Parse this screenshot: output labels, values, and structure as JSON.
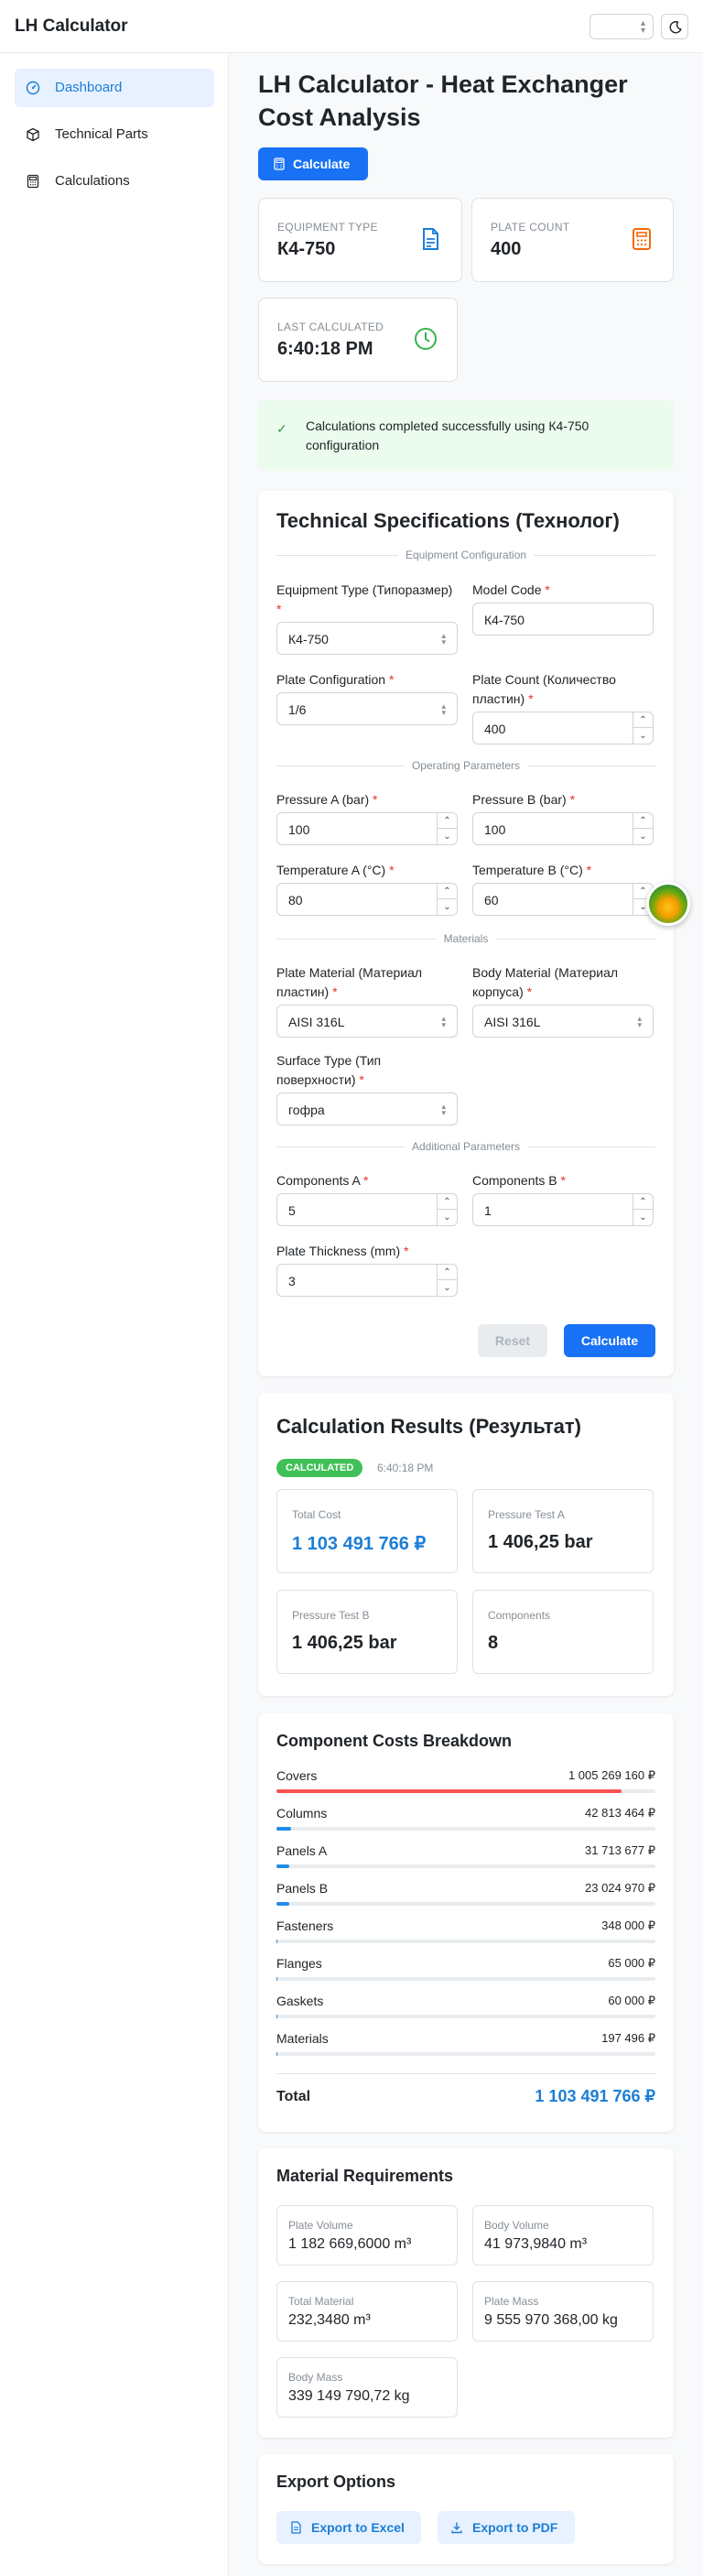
{
  "app": {
    "title": "LH Calculator"
  },
  "sidebar": {
    "items": [
      {
        "label": "Dashboard",
        "icon": "gauge-icon",
        "active": true
      },
      {
        "label": "Technical Parts",
        "icon": "box-icon",
        "active": false
      },
      {
        "label": "Calculations",
        "icon": "calculator-icon",
        "active": false
      }
    ]
  },
  "page": {
    "title": "LH Calculator - Heat Exchanger Cost Analysis",
    "calculate_label": "Calculate"
  },
  "stats": {
    "equipment_type": {
      "label": "EQUIPMENT TYPE",
      "value": "К4-750"
    },
    "plate_count": {
      "label": "PLATE COUNT",
      "value": "400"
    },
    "last_calculated": {
      "label": "LAST CALCULATED",
      "value": "6:40:18 PM"
    }
  },
  "alert": {
    "text": "Calculations completed successfully using К4-750 configuration"
  },
  "specs": {
    "title": "Technical Specifications (Технолог)",
    "sections": {
      "equipment": "Equipment Configuration",
      "operating": "Operating Parameters",
      "materials": "Materials",
      "additional": "Additional Parameters"
    },
    "fields": {
      "equipment_type": {
        "label": "Equipment Type (Типоразмер)",
        "value": "К4-750"
      },
      "model_code": {
        "label": "Model Code",
        "value": "К4-750"
      },
      "plate_config": {
        "label": "Plate Configuration",
        "value": "1/6"
      },
      "plate_count": {
        "label": "Plate Count (Количество пластин)",
        "value": "400"
      },
      "pressure_a": {
        "label": "Pressure A (bar)",
        "value": "100"
      },
      "pressure_b": {
        "label": "Pressure B (bar)",
        "value": "100"
      },
      "temp_a": {
        "label": "Temperature A (°C)",
        "value": "80"
      },
      "temp_b": {
        "label": "Temperature B (°C)",
        "value": "60"
      },
      "plate_material": {
        "label": "Plate Material (Материал пластин)",
        "value": "AISI 316L"
      },
      "body_material": {
        "label": "Body Material (Материал корпуса)",
        "value": "AISI 316L"
      },
      "surface_type": {
        "label": "Surface Type (Тип поверхности)",
        "value": "гофра"
      },
      "components_a": {
        "label": "Components A",
        "value": "5"
      },
      "components_b": {
        "label": "Components B",
        "value": "1"
      },
      "plate_thickness": {
        "label": "Plate Thickness (mm)",
        "value": "3"
      }
    },
    "reset_label": "Reset",
    "calculate_label": "Calculate"
  },
  "results": {
    "title": "Calculation Results (Результат)",
    "badge": "CALCULATED",
    "time": "6:40:18 PM",
    "cards": [
      {
        "label": "Total Cost",
        "value": "1 103 491 766 ₽"
      },
      {
        "label": "Pressure Test A",
        "value": "1 406,25 bar"
      },
      {
        "label": "Pressure Test B",
        "value": "1 406,25 bar"
      },
      {
        "label": "Components",
        "value": "8"
      }
    ]
  },
  "breakdown": {
    "title": "Component Costs Breakdown",
    "rows": [
      {
        "name": "Covers",
        "amount": "1 005 269 160 ₽",
        "share": 0.911,
        "color": "#fa5252"
      },
      {
        "name": "Columns",
        "amount": "42 813 464 ₽",
        "share": 0.039,
        "color": "#228be6"
      },
      {
        "name": "Panels A",
        "amount": "31 713 677 ₽",
        "share": 0.029,
        "color": "#228be6"
      },
      {
        "name": "Panels B",
        "amount": "23 024 970 ₽",
        "share": 0.021,
        "color": "#228be6"
      },
      {
        "name": "Fasteners",
        "amount": "348 000 ₽",
        "share": 0.0003,
        "color": "#228be6"
      },
      {
        "name": "Flanges",
        "amount": "65 000 ₽",
        "share": 0.0001,
        "color": "#228be6"
      },
      {
        "name": "Gaskets",
        "amount": "60 000 ₽",
        "share": 0.0001,
        "color": "#228be6"
      },
      {
        "name": "Materials",
        "amount": "197 496 ₽",
        "share": 0.0002,
        "color": "#228be6"
      }
    ],
    "total_label": "Total",
    "total_value": "1 103 491 766 ₽"
  },
  "materials": {
    "title": "Material Requirements",
    "cards": [
      {
        "label": "Plate Volume",
        "value": "1 182 669,6000 m³"
      },
      {
        "label": "Body Volume",
        "value": "41 973,9840 m³"
      },
      {
        "label": "Total Material",
        "value": "232,3480 m³"
      },
      {
        "label": "Plate Mass",
        "value": "9 555 970 368,00 kg"
      },
      {
        "label": "Body Mass",
        "value": "339 149 790,72 kg"
      }
    ]
  },
  "export": {
    "title": "Export Options",
    "excel_label": "Export to Excel",
    "pdf_label": "Export to PDF"
  }
}
